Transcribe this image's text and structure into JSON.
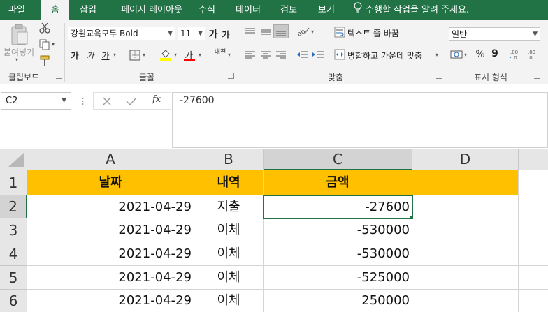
{
  "tabs": [
    "파일",
    "홈",
    "삽입",
    "페이지 레이아웃",
    "수식",
    "데이터",
    "검토",
    "보기"
  ],
  "active_tab": "홈",
  "tell_me": "수행할 작업을 알려 주세요.",
  "ribbon": {
    "clipboard": {
      "paste_label": "붙여넣기",
      "group_label": "클립보드"
    },
    "font": {
      "font_name": "강원교육모두 Bold",
      "font_size": "11",
      "grow_label": "가",
      "shrink_label": "가",
      "bold_label": "가",
      "italic_label": "가",
      "underline_label": "가",
      "font_color_label": "가",
      "phonetic_label": "내천",
      "group_label": "글꼴",
      "highlight_color": "#ffff00",
      "font_color": "#ff0000"
    },
    "alignment": {
      "wrap_text": "텍스트 줄 바꿈",
      "merge_center": "병합하고 가운데 맞춤",
      "group_label": "맞춤"
    },
    "number": {
      "format": "일반",
      "percent": "%",
      "comma": "9",
      "group_label": "표시 형식"
    }
  },
  "formula_bar": {
    "name_box": "C2",
    "fx": "fx",
    "value": "-27600"
  },
  "grid": {
    "columns": [
      "A",
      "B",
      "C",
      "D"
    ],
    "rows": [
      "1",
      "2",
      "3",
      "4",
      "5",
      "6"
    ],
    "header": [
      "날짜",
      "내역",
      "금액",
      ""
    ],
    "data": [
      [
        "2021-04-29",
        "지출",
        "-27600",
        ""
      ],
      [
        "2021-04-29",
        "이체",
        "-530000",
        ""
      ],
      [
        "2021-04-29",
        "이체",
        "-530000",
        ""
      ],
      [
        "2021-04-29",
        "이체",
        "-525000",
        ""
      ],
      [
        "2021-04-29",
        "이체",
        "250000",
        ""
      ]
    ],
    "selected_cell": "C2",
    "header_fill": "#ffc000"
  },
  "colors": {
    "accent": "#217346"
  }
}
